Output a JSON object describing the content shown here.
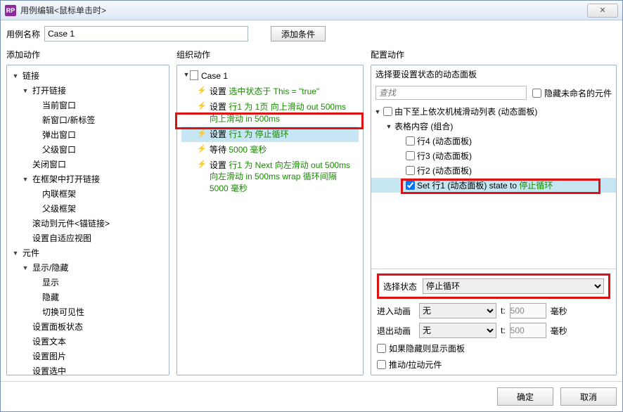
{
  "window": {
    "rp": "RP",
    "title": "用例编辑<鼠标单击时>",
    "close": "✕"
  },
  "nameRow": {
    "label": "用例名称",
    "value": "Case 1",
    "addCondition": "添加条件"
  },
  "cols": {
    "left": "添加动作",
    "mid": "组织动作",
    "right": "配置动作"
  },
  "leftTree": [
    {
      "l": 0,
      "exp": "▼",
      "label": "链接"
    },
    {
      "l": 1,
      "exp": "▼",
      "label": "打开链接"
    },
    {
      "l": 2,
      "exp": "",
      "label": "当前窗口"
    },
    {
      "l": 2,
      "exp": "",
      "label": "新窗口/新标签"
    },
    {
      "l": 2,
      "exp": "",
      "label": "弹出窗口"
    },
    {
      "l": 2,
      "exp": "",
      "label": "父级窗口"
    },
    {
      "l": 1,
      "exp": "",
      "label": "关闭窗口"
    },
    {
      "l": 1,
      "exp": "▼",
      "label": "在框架中打开链接"
    },
    {
      "l": 2,
      "exp": "",
      "label": "内联框架"
    },
    {
      "l": 2,
      "exp": "",
      "label": "父级框架"
    },
    {
      "l": 1,
      "exp": "",
      "label": "滚动到元件<锚链接>"
    },
    {
      "l": 1,
      "exp": "",
      "label": "设置自适应视图"
    },
    {
      "l": 0,
      "exp": "▼",
      "label": "元件"
    },
    {
      "l": 1,
      "exp": "▼",
      "label": "显示/隐藏"
    },
    {
      "l": 2,
      "exp": "",
      "label": "显示"
    },
    {
      "l": 2,
      "exp": "",
      "label": "隐藏"
    },
    {
      "l": 2,
      "exp": "",
      "label": "切换可见性"
    },
    {
      "l": 1,
      "exp": "",
      "label": "设置面板状态"
    },
    {
      "l": 1,
      "exp": "",
      "label": "设置文本"
    },
    {
      "l": 1,
      "exp": "",
      "label": "设置图片"
    },
    {
      "l": 1,
      "exp": "",
      "label": "设置选中"
    }
  ],
  "org": {
    "caseLabel": "Case 1",
    "rows": [
      {
        "pre": "设置 ",
        "g": "选中状态于 This = \"true\""
      },
      {
        "pre": "设置 ",
        "g": "行1 为 1页 向上滑动 out 500ms 向上滑动 in 500ms"
      },
      {
        "pre": "设置 ",
        "g": "行1 为 停止循环",
        "sel": true
      },
      {
        "pre": "等待 ",
        "g": "5000 毫秒"
      },
      {
        "pre": "设置 ",
        "g": "行1 为 Next 向左滑动 out 500ms 向左滑动 in 500ms wrap 循环间隔 5000 毫秒"
      }
    ]
  },
  "cfg": {
    "head": "选择要设置状态的动态面板",
    "searchPlaceholder": "查找",
    "hideUnnamed": "隐藏未命名的元件",
    "tree": [
      {
        "l": 0,
        "exp": "▼",
        "chk": false,
        "label": "由下至上依次机械滑动列表 (动态面板)"
      },
      {
        "l": 1,
        "exp": "▼",
        "chk": null,
        "label": "表格内容 (组合)"
      },
      {
        "l": 2,
        "exp": "",
        "chk": false,
        "label": "行4 (动态面板)"
      },
      {
        "l": 2,
        "exp": "",
        "chk": false,
        "label": "行3 (动态面板)"
      },
      {
        "l": 2,
        "exp": "",
        "chk": false,
        "label": "行2 (动态面板)"
      },
      {
        "l": 2,
        "exp": "",
        "chk": true,
        "sel": true,
        "label_pre": "Set 行1 (动态面板) state to ",
        "label_g": "停止循环"
      }
    ],
    "selectState": {
      "label": "选择状态",
      "value": "停止循环"
    },
    "enter": {
      "label": "进入动画",
      "anim": "无",
      "t": "t:",
      "ms": "500",
      "unit": "毫秒"
    },
    "exit": {
      "label": "退出动画",
      "anim": "无",
      "t": "t:",
      "ms": "500",
      "unit": "毫秒"
    },
    "opt1": "如果隐藏则显示面板",
    "opt2": "推动/拉动元件"
  },
  "footer": {
    "ok": "确定",
    "cancel": "取消"
  }
}
